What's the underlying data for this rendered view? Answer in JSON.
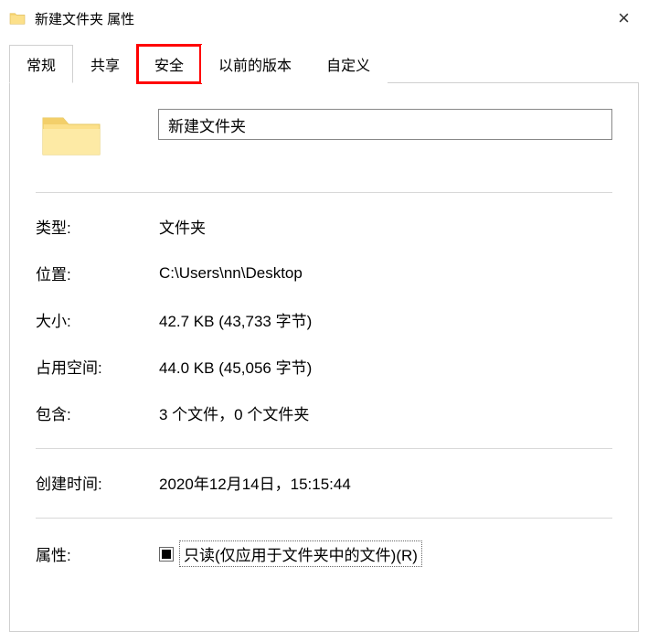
{
  "titlebar": {
    "title": "新建文件夹 属性",
    "close": "×"
  },
  "tabs": {
    "t0": "常规",
    "t1": "共享",
    "t2": "安全",
    "t3": "以前的版本",
    "t4": "自定义"
  },
  "general": {
    "name_value": "新建文件夹",
    "type_label": "类型:",
    "type_value": "文件夹",
    "location_label": "位置:",
    "location_value": "C:\\Users\\nn\\Desktop",
    "size_label": "大小:",
    "size_value": "42.7 KB (43,733 字节)",
    "sizeondisk_label": "占用空间:",
    "sizeondisk_value": "44.0 KB (45,056 字节)",
    "contains_label": "包含:",
    "contains_value": "3 个文件，0 个文件夹",
    "created_label": "创建时间:",
    "created_value": "2020年12月14日，15:15:44",
    "attributes_label": "属性:",
    "readonly_label": "只读(仅应用于文件夹中的文件)(R)"
  }
}
